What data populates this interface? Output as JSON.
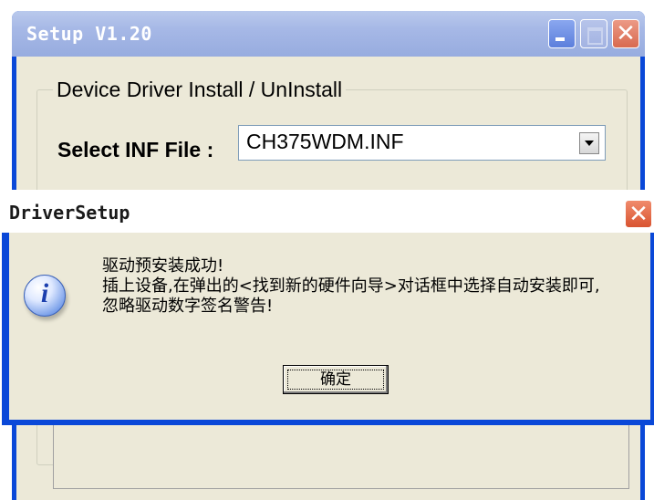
{
  "setup_window": {
    "title": "Setup V1.20",
    "controls": {
      "minimize": "minimize",
      "maximize": "maximize",
      "close": "✕"
    },
    "group_title": "Device Driver Install / UnInstall",
    "inf_label": "Select INF File :",
    "inf_value": "CH375WDM.INF"
  },
  "dialog": {
    "title": "DriverSetup",
    "close": "✕",
    "icon": "info-icon",
    "icon_glyph": "i",
    "message": "驱动预安装成功!\n插上设备,在弹出的<找到新的硬件向导>对话框中选择自动安装即可,\n忽略驱动数字签名警告!",
    "ok_label": "确定"
  },
  "colors": {
    "titlebar_blue": "#0a48d8",
    "window_face": "#ece9d8",
    "close_red": "#d95431"
  }
}
